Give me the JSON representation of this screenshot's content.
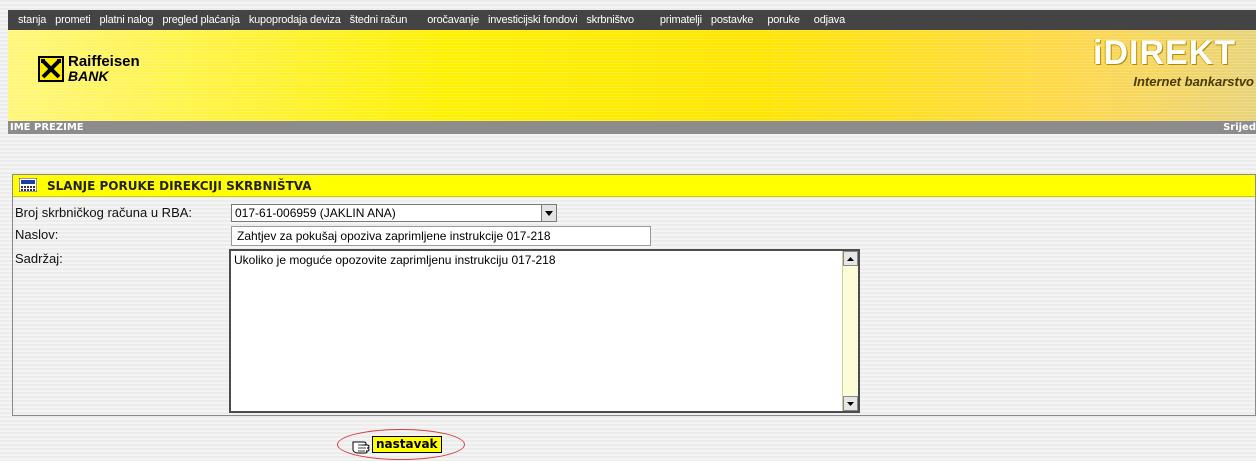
{
  "nav": {
    "items": [
      "stanja",
      "prometi",
      "platni nalog",
      "pregled plaćanja",
      "kupoprodaja deviza",
      "štedni račun",
      "oročavanje",
      "investicijski fondovi",
      "skrbništvo",
      "primatelji",
      "postavke",
      "poruke",
      "odjava"
    ]
  },
  "banner": {
    "logo_line1": "Raiffeisen",
    "logo_line2": "BANK",
    "brand_title": "iDIREKT",
    "brand_subtitle": "Internet bankarstvo",
    "colors": {
      "yellow": "#ffee00",
      "nav_bg": "#444444"
    }
  },
  "userbar": {
    "name": "IME PREZIME",
    "day": "Srijed"
  },
  "form": {
    "title": "SLANJE PORUKE DIREKCIJI SKRBNIŠTVA",
    "account_label": "Broj skrbničkog računa u RBA:",
    "account_value": "017-61-006959 (JAKLIN ANA)",
    "subject_label": "Naslov:",
    "subject_value": "Zahtjev za pokušaj opoziva zaprimljene instrukcije 017-218",
    "content_label": "Sadržaj:",
    "content_value": "Ukoliko je moguće opozovite zaprimljenu instrukciju 017-218",
    "submit_label": "nastavak",
    "header_color": "#ffff00",
    "highlight_color": "#d83c3c"
  }
}
